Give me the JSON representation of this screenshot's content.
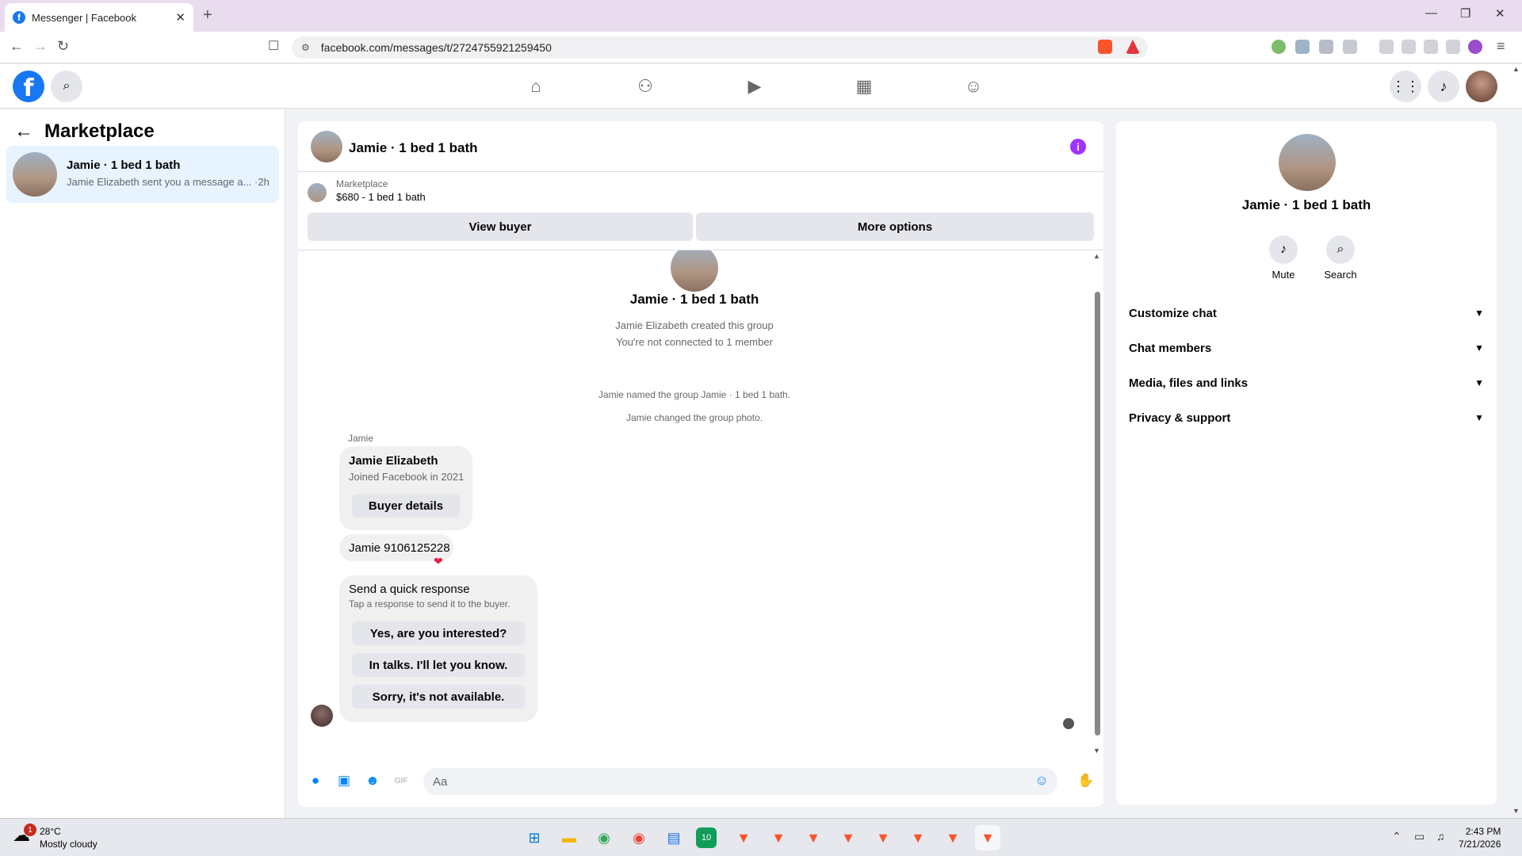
{
  "browser": {
    "tab_title": "Messenger | Facebook",
    "tab_favicon": "f",
    "url": "facebook.com/messages/t/2724755921259450",
    "close_glyph": "✕",
    "new_tab_glyph": "+"
  },
  "fb": {
    "logo": "f"
  },
  "sidebar": {
    "title": "Marketplace",
    "conversations": [
      {
        "name": "Jamie · 1 bed 1 bath",
        "preview": "Jamie Elizabeth sent you a message a... ·2h"
      }
    ]
  },
  "chat": {
    "title": "Jamie · 1 bed 1 bath",
    "marketplace_label": "Marketplace",
    "listing": "$680 - 1 bed 1 bath",
    "view_buyer": "View buyer",
    "more_options": "More options",
    "group_name": "Jamie · 1 bed 1 bath",
    "created": "Jamie Elizabeth created this group",
    "not_connected": "You're not connected to 1 member",
    "named_event": "Jamie named the group Jamie · 1 bed 1 bath.",
    "photo_event": "Jamie changed the group photo.",
    "sender_label": "Jamie",
    "card_name": "Jamie Elizabeth",
    "card_joined": "Joined Facebook in 2021",
    "buyer_details": "Buyer details",
    "message_text": "Jamie 9106125228",
    "reaction": "❤",
    "quick_title": "Send a quick response",
    "quick_sub": "Tap a response to send it to the buyer.",
    "quick_responses": [
      "Yes, are you interested?",
      "In talks. I'll let you know.",
      "Sorry, it's not available."
    ],
    "composer_placeholder": "Aa"
  },
  "rpanel": {
    "name": "Jamie · 1 bed 1 bath",
    "mute": "Mute",
    "search": "Search",
    "sections": [
      "Customize chat",
      "Chat members",
      "Media, files and links",
      "Privacy & support"
    ]
  },
  "taskbar": {
    "temp": "28°C",
    "condition": "Mostly cloudy",
    "badge": "1",
    "time": "2:43 PM",
    "date": "7/21/2026"
  },
  "colors": {
    "accent": "#1877f2",
    "messenger": "#0084ff",
    "info": "#a033ff",
    "reaction": "#e41e3f"
  }
}
